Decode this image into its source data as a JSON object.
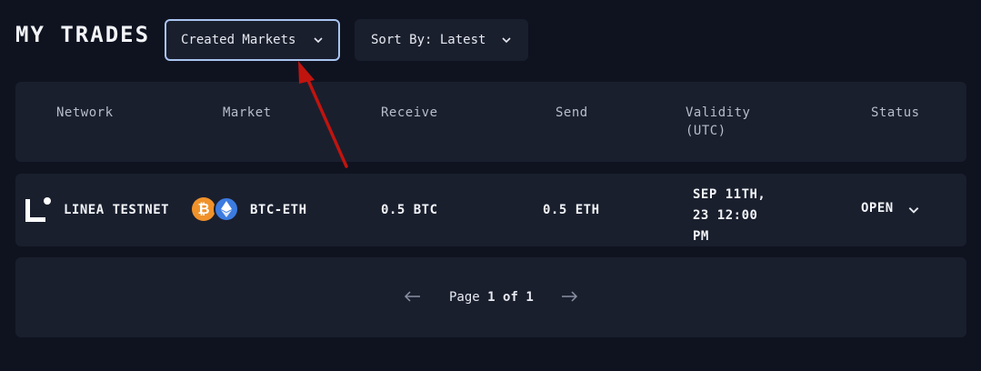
{
  "page": {
    "title": "MY TRADES"
  },
  "filters": {
    "market_filter": {
      "value": "Created Markets"
    },
    "sort": {
      "value": "Sort By: Latest"
    }
  },
  "table": {
    "columns": [
      "Network",
      "Market",
      "Receive",
      "Send",
      "Validity (UTC)",
      "Status"
    ],
    "validity_header_line1": "Validity",
    "validity_header_line2": "(UTC)",
    "rows": [
      {
        "network": "LINEA TESTNET",
        "network_icon": "linea-logo",
        "market": "BTC-ETH",
        "market_icons": [
          "bitcoin-icon",
          "ethereum-icon"
        ],
        "receive": "0.5 BTC",
        "send": "0.5 ETH",
        "validity_line1": "SEP 11TH,",
        "validity_line2": "23 12:00",
        "validity_line3": "PM",
        "status": "OPEN"
      }
    ]
  },
  "pagination": {
    "prefix": "Page",
    "current": "1",
    "separator": "of",
    "total": "1"
  },
  "colors": {
    "background": "#0f1320",
    "panel": "#1a1f2e",
    "focus_border": "#a9c4ef",
    "bitcoin": "#f0922a",
    "ethereum": "#3c7be0",
    "annotation_arrow": "#c0140f"
  }
}
